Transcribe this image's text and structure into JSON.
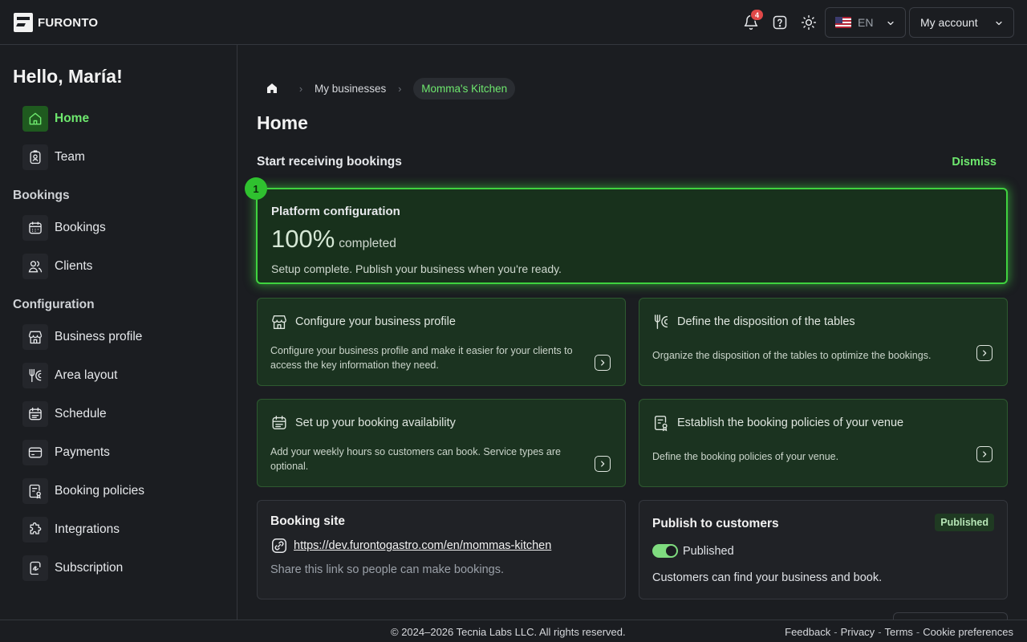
{
  "brand": {
    "name": "FURONTO"
  },
  "header": {
    "notifications_count": "4",
    "language": "EN",
    "account_label": "My account"
  },
  "sidebar": {
    "greeting": "Hello, María!",
    "top_items": [
      {
        "label": "Home",
        "icon": "home-icon",
        "active": true
      },
      {
        "label": "Team",
        "icon": "badge-icon"
      }
    ],
    "sections": [
      {
        "label": "Bookings",
        "items": [
          {
            "label": "Bookings",
            "icon": "calendar-icon"
          },
          {
            "label": "Clients",
            "icon": "users-icon"
          }
        ]
      },
      {
        "label": "Configuration",
        "items": [
          {
            "label": "Business profile",
            "icon": "storefront-icon"
          },
          {
            "label": "Area layout",
            "icon": "utensils-icon"
          },
          {
            "label": "Schedule",
            "icon": "schedule-icon"
          },
          {
            "label": "Payments",
            "icon": "card-icon"
          },
          {
            "label": "Booking policies",
            "icon": "policy-icon"
          },
          {
            "label": "Integrations",
            "icon": "puzzle-icon"
          },
          {
            "label": "Subscription",
            "icon": "subscription-icon"
          }
        ]
      }
    ]
  },
  "breadcrumb": {
    "items": [
      "My businesses",
      "Momma's Kitchen"
    ]
  },
  "main": {
    "title": "Home",
    "section_title": "Start receiving bookings",
    "dismiss_label": "Dismiss",
    "platform_config": {
      "step": "1",
      "title": "Platform configuration",
      "percent": "100%",
      "percent_label": "completed",
      "description": "Setup complete. Publish your business when you're ready."
    },
    "tasks": [
      {
        "title": "Configure your business profile",
        "description": "Configure your business profile and make it easier for your clients to access the key information they need.",
        "icon": "storefront-icon"
      },
      {
        "title": "Define the disposition of the tables",
        "description": "Organize the disposition of the tables to optimize the bookings.",
        "icon": "utensils-icon"
      },
      {
        "title": "Set up your booking availability",
        "description": "Add your weekly hours so customers can book. Service types are optional.",
        "icon": "schedule-icon"
      },
      {
        "title": "Establish the booking policies of your venue",
        "description": "Define the booking policies of your venue.",
        "icon": "policy-icon"
      }
    ],
    "booking_site": {
      "title": "Booking site",
      "url": "https://dev.furontogastro.com/en/mommas-kitchen",
      "description": "Share this link so people can make bookings."
    },
    "publish": {
      "title": "Publish to customers",
      "badge": "Published",
      "toggle_label": "Published",
      "toggle_on": true,
      "description": "Customers can find your business and book."
    }
  },
  "footer": {
    "copyright": "© 2024–2026 Tecnia Labs LLC. All rights reserved.",
    "links": [
      "Feedback",
      "Privacy",
      "Terms",
      "Cookie preferences"
    ]
  },
  "colors": {
    "accent": "#6ee86e",
    "background": "#1b1d21",
    "task_card_bg": "#1b3320",
    "badge_red": "#e04848"
  }
}
